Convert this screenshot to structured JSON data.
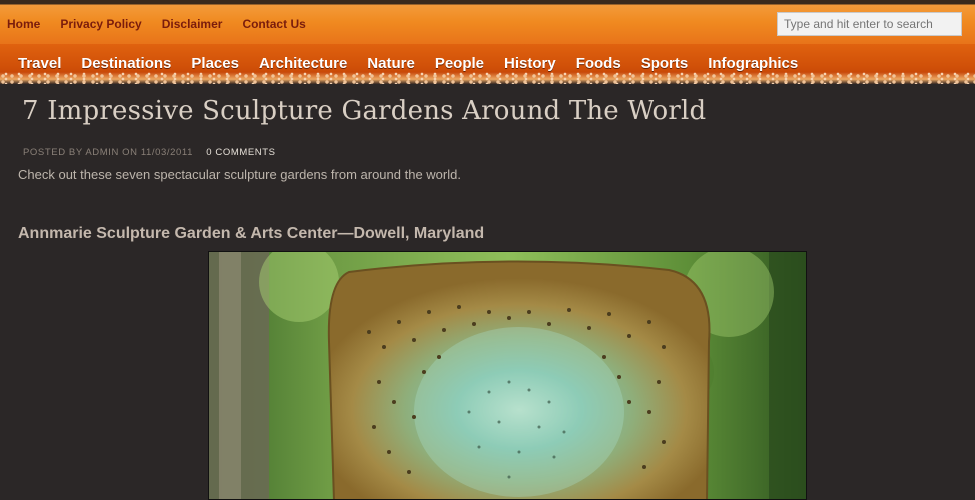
{
  "top_nav": {
    "links": [
      "Home",
      "Privacy Policy",
      "Disclaimer",
      "Contact Us"
    ],
    "search_placeholder": "Type and hit enter to search"
  },
  "main_nav": {
    "items": [
      "Travel",
      "Destinations",
      "Places",
      "Architecture",
      "Nature",
      "People",
      "History",
      "Foods",
      "Sports",
      "Infographics"
    ]
  },
  "post": {
    "title": "7 Impressive Sculpture Gardens Around The World",
    "meta_prefix": "POSTED BY ADMIN  ON 11/03/2011",
    "comments": "0 COMMENTS",
    "intro": "Check out these seven spectacular sculpture gardens from around the world.",
    "section_heading": "Annmarie Sculpture Garden & Arts Center—Dowell, Maryland"
  },
  "colors": {
    "page_bg": "#2b2727",
    "top_bar": "#f08a20",
    "nav_bar": "#cf4f08",
    "top_link": "#7a1c0c"
  },
  "icons": []
}
